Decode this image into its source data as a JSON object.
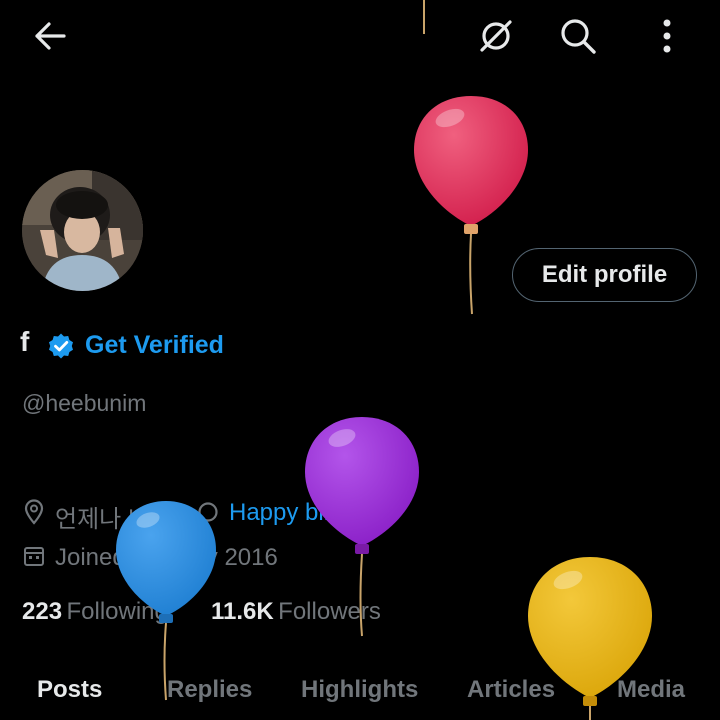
{
  "header": {
    "back_icon": "arrow-left-icon",
    "grok_icon": "slash-circle-icon",
    "search_icon": "search-icon",
    "more_icon": "more-vertical-icon"
  },
  "profile": {
    "edit_label": "Edit profile",
    "display_name": "f",
    "get_verified": "Get Verified",
    "handle": "@heebunim",
    "location": "언제나 네 편",
    "website": "Happy birthday!",
    "joined": "Joined January 2016",
    "following_count": "223",
    "following_label": "Following",
    "followers_count": "11.6K",
    "followers_label": "Followers"
  },
  "tabs": [
    {
      "label": "Posts"
    },
    {
      "label": "Replies"
    },
    {
      "label": "Highlights"
    },
    {
      "label": "Articles"
    },
    {
      "label": "Media"
    }
  ],
  "colors": {
    "accent": "#1d9bf0",
    "background": "#000000",
    "balloon_red": "#e8345a",
    "balloon_purple": "#9b2fd6",
    "balloon_blue": "#2e8fe0",
    "balloon_yellow": "#e9b411"
  }
}
